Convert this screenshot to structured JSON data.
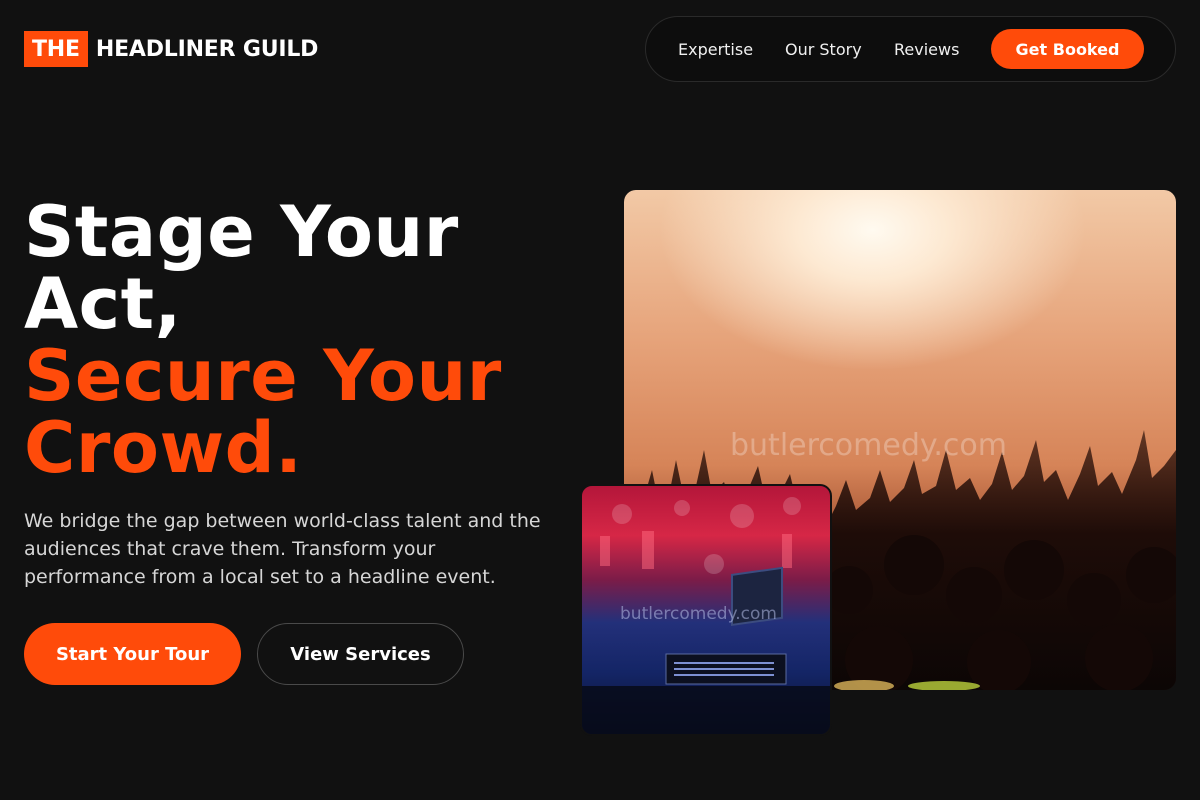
{
  "header": {
    "logo_boxed": "THE",
    "logo_rest": "HEADLINER GUILD",
    "nav": [
      {
        "label": "Expertise"
      },
      {
        "label": "Our Story"
      },
      {
        "label": "Reviews"
      }
    ],
    "cta_label": "Get Booked"
  },
  "hero": {
    "title_line1": "Stage Your",
    "title_line2": "Act,",
    "title_accent_line1": "Secure Your",
    "title_accent_line2": "Crowd.",
    "description": "We bridge the gap between world-class talent and the audiences that crave them. Transform your performance from a local set to a headline event.",
    "primary_button": "Start Your Tour",
    "secondary_button": "View Services"
  },
  "images": {
    "main_watermark": "butlercomedy.com",
    "inset_watermark": "butlercomedy.com"
  },
  "colors": {
    "accent": "#ff4b0a",
    "background": "#111111"
  }
}
